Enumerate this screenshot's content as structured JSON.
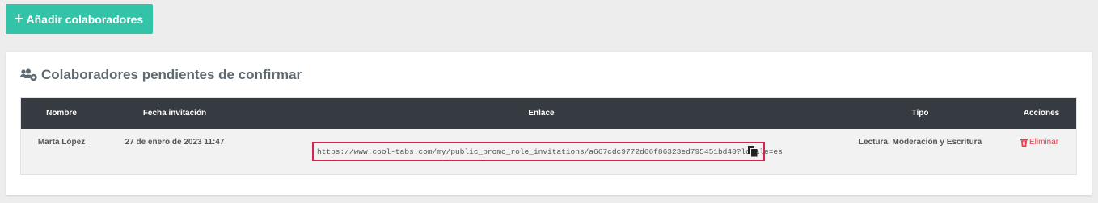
{
  "toolbar": {
    "add_button_label": "Añadir colaboradores",
    "add_button_icon": "plus-icon"
  },
  "panel": {
    "title": "Colaboradores pendientes de confirmar",
    "title_icon": "users-cog-icon"
  },
  "table": {
    "headers": [
      "Nombre",
      "Fecha invitación",
      "Enlace",
      "Tipo",
      "Acciones"
    ],
    "rows": [
      {
        "name": "Marta López",
        "date": "27 de enero de 2023 11:47",
        "link": "https://www.cool-tabs.com/my/public_promo_role_invitations/a667cdc9772d66f86323ed795451bd40?locale=es",
        "type": "Lectura, Moderación y Escritura",
        "action_label": "Eliminar"
      }
    ]
  },
  "colors": {
    "accent": "#33c3a8",
    "table_header": "#363b42",
    "highlight_border": "#d6204e",
    "danger": "#e0404a"
  }
}
